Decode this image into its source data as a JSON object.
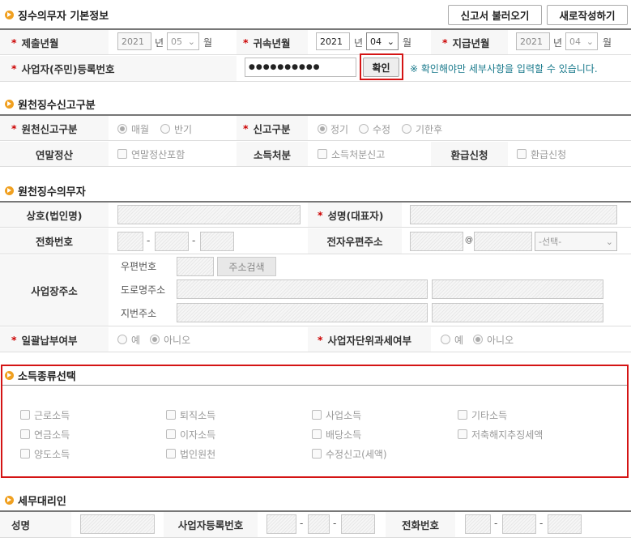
{
  "sections": {
    "basic": "징수의무자 기본정보",
    "report_type": "원천징수신고구분",
    "agent": "원천징수의무자",
    "income": "소득종류선택",
    "tax_agent": "세무대리인"
  },
  "toolbar": {
    "load": "신고서 불러오기",
    "new": "새로작성하기"
  },
  "basic": {
    "submit_label": "제출년월",
    "submit_year": "2021",
    "submit_month": "05",
    "attr_label": "귀속년월",
    "attr_year": "2021",
    "attr_month": "04",
    "pay_label": "지급년월",
    "pay_year": "2021",
    "pay_month": "04",
    "year_unit": "년",
    "month_unit": "월",
    "reg_label": "사업자(주민)등록번호",
    "reg_value": "●●●●●●●●●●",
    "confirm": "확인",
    "notice": "※ 확인해야만 세부사항을 입력할 수 있습니다."
  },
  "report": {
    "kind_label": "원천신고구분",
    "monthly": "매월",
    "half": "반기",
    "type_label": "신고구분",
    "regular": "정기",
    "revise": "수정",
    "late": "기한후",
    "yearend_label": "연말정산",
    "yearend_chk": "연말정산포함",
    "disposal_label": "소득처분",
    "disposal_chk": "소득처분신고",
    "refund_label": "환급신청",
    "refund_chk": "환급신청"
  },
  "agent": {
    "company_label": "상호(법인명)",
    "name_label": "성명(대표자)",
    "phone_label": "전화번호",
    "email_label": "전자우편주소",
    "email_at": "@",
    "email_select": "-선택-",
    "addr_label": "사업장주소",
    "zip_label": "우편번호",
    "zip_btn": "주소검색",
    "road_label": "도로명주소",
    "lot_label": "지번주소",
    "lump_label": "일괄납부여부",
    "yes": "예",
    "no": "아니오",
    "unit_label": "사업자단위과세여부",
    "dash": "-"
  },
  "income": {
    "items": [
      "근로소득",
      "퇴직소득",
      "사업소득",
      "기타소득",
      "연금소득",
      "이자소득",
      "배당소득",
      "저축해지추징세액",
      "양도소득",
      "법인원천",
      "수정신고(세액)"
    ]
  },
  "tax_agent": {
    "name_label": "성명",
    "biz_label": "사업자등록번호",
    "phone_label": "전화번호"
  }
}
